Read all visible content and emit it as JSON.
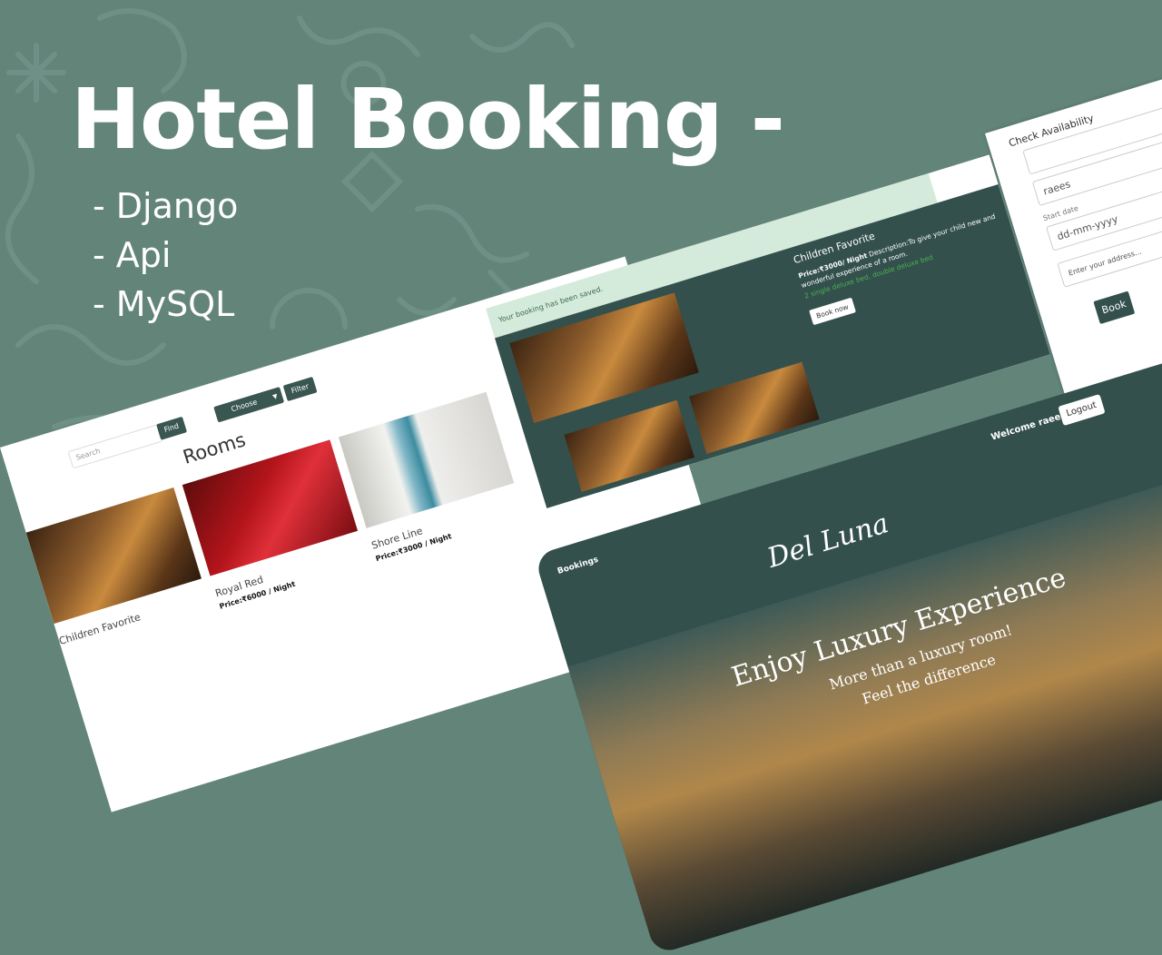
{
  "headline": {
    "title": "Hotel Booking -",
    "stack": [
      "- Django",
      "- Api",
      "- MySQL"
    ]
  },
  "rooms_page": {
    "search_placeholder": "Search",
    "find_label": "Find",
    "choose_label": "Choose",
    "filter_label": "Filter",
    "heading": "Rooms",
    "cards": [
      {
        "name": "Children Favorite",
        "price": ""
      },
      {
        "name": "Royal Red",
        "price": "Price:₹6000 / Night"
      },
      {
        "name": "Shore Line",
        "price": "Price:₹3000 / Night"
      }
    ]
  },
  "availability": {
    "heading": "Check Availability",
    "name_value": "raees",
    "start_label": "Start date",
    "date_placeholder": "dd-mm-yyyy",
    "address_placeholder": "Enter your address...",
    "book_label": "Book"
  },
  "booking_detail": {
    "alert": "Your booking has been saved.",
    "room_name": "Children Favorite",
    "price": "Price:₹3000/ Night",
    "description": "Description:To give your child new and wonderful experience of a room.",
    "beds": "2 single deluxe bed, double deluxe bed",
    "book_now_label": "Book now"
  },
  "landing": {
    "nav_bookings": "Bookings",
    "welcome": "Welcome raees",
    "logout_label": "Logout",
    "brand": "Del Luna",
    "hero_title": "Enjoy Luxury Experience",
    "hero_line_1": "More than a luxury room!",
    "hero_line_2": "Feel the difference"
  },
  "colors": {
    "background": "#628479",
    "panel": "#33504d",
    "accent_green": "#4caf50",
    "alert_bg": "#d4eadb"
  }
}
